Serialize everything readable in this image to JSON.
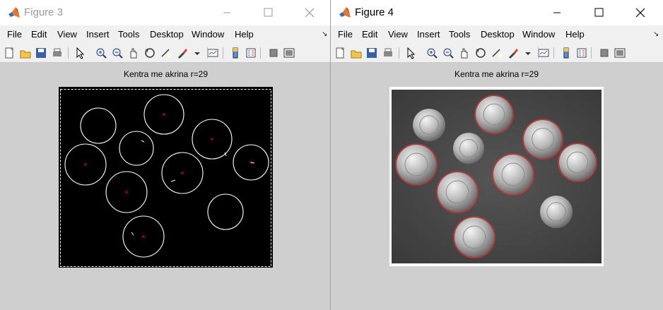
{
  "colors": {
    "accent": "#e8762b",
    "marker": "#ff2020",
    "coin_outline": "#e03030"
  },
  "figure3": {
    "title": "Figure 3",
    "plot_title": "Kentra me akrina r=29",
    "icons": [
      "matlab-logo-icon",
      "minimize-icon",
      "maximize-icon",
      "close-icon"
    ]
  },
  "figure4": {
    "title": "Figure 4",
    "plot_title": "Kentra me akrina r=29"
  },
  "menu": [
    "File",
    "Edit",
    "View",
    "Insert",
    "Tools",
    "Desktop",
    "Window",
    "Help"
  ],
  "toolbar_icons": [
    "new-figure-icon",
    "open-file-icon",
    "save-icon",
    "print-icon",
    "pointer-icon",
    "zoom-in-icon",
    "zoom-out-icon",
    "pan-icon",
    "rotate-3d-icon",
    "data-cursor-icon",
    "brush-icon",
    "dropdown-arrow-icon",
    "link-plot-icon",
    "colorbar-icon",
    "legend-icon",
    "hide-plot-tools-icon",
    "show-plot-tools-icon"
  ]
}
